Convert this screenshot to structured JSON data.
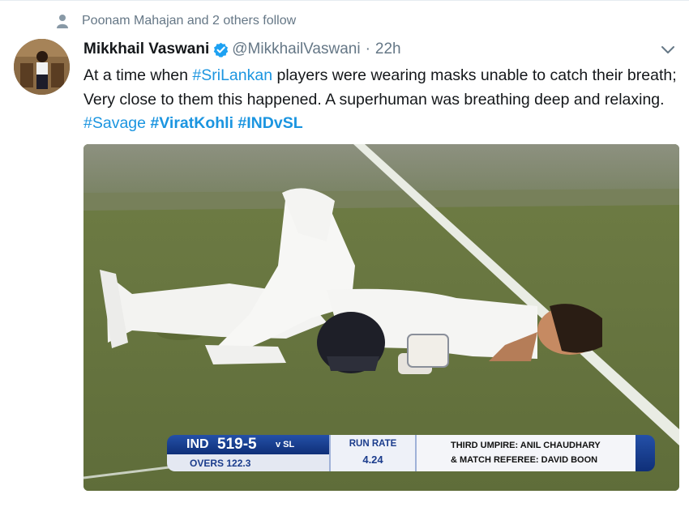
{
  "social_context": {
    "text": "Poonam Mahajan and 2 others follow",
    "icon": "person-icon"
  },
  "tweet": {
    "author_name": "Mikkhail Vaswani",
    "verified": true,
    "handle": "@MikkhailVaswani",
    "separator": "·",
    "time": "22h",
    "text_parts": [
      {
        "text": "At a time when ",
        "type": "plain"
      },
      {
        "text": "#SriLankan",
        "type": "hashtag"
      },
      {
        "text": " players were wearing masks unable to catch their breath; Very close to them this happened. A superhuman was breathing deep and relaxing. ",
        "type": "plain"
      },
      {
        "text": "#Savage",
        "type": "hashtag"
      },
      {
        "text": " ",
        "type": "plain"
      },
      {
        "text": "#ViratKohli",
        "type": "hashtag-bold"
      },
      {
        "text": " ",
        "type": "plain"
      },
      {
        "text": "#INDvSL",
        "type": "hashtag-bold"
      }
    ]
  },
  "media": {
    "scorebar": {
      "team": "IND",
      "score": "519-5",
      "vs": "v SL",
      "overs": "OVERS 122.3",
      "run_rate_label": "RUN RATE",
      "run_rate": "4.24",
      "line1": "THIRD UMPIRE:  ANIL CHAUDHARY",
      "line2": "& MATCH REFEREE:  DAVID BOON"
    }
  },
  "colors": {
    "link": "#1b95e0",
    "muted": "#657786",
    "verified": "#1da1f2",
    "scorebar_blue": "#1b3c8c"
  }
}
